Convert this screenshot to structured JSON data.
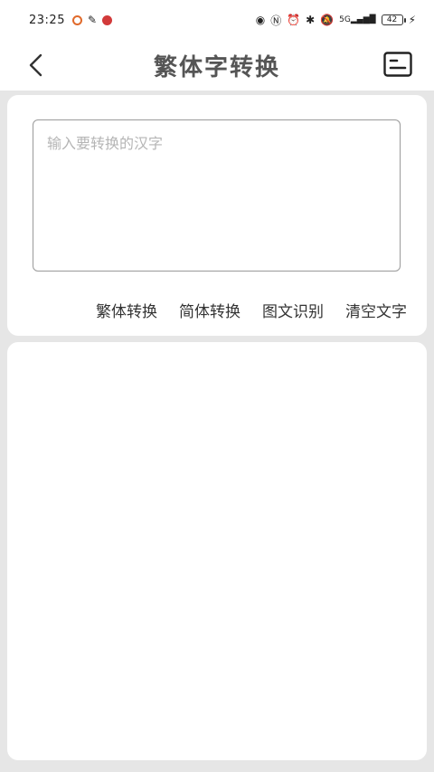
{
  "status_bar": {
    "time": "23:25",
    "battery": "42",
    "network": "5G",
    "left_icons": [
      "app-notification-icon",
      "text-app-icon",
      "red-app-icon"
    ],
    "right_icons": [
      "eye-icon",
      "nfc-icon",
      "alarm-icon",
      "bluetooth-icon",
      "mute-icon",
      "signal-icon",
      "battery-icon",
      "charging-icon"
    ]
  },
  "header": {
    "title": "繁体字转换",
    "back_icon": "chevron-left-icon",
    "history_icon": "list-card-icon"
  },
  "input": {
    "placeholder": "输入要转换的汉字",
    "value": ""
  },
  "actions": [
    {
      "label": "繁体转换"
    },
    {
      "label": "简体转换"
    },
    {
      "label": "图文识别"
    },
    {
      "label": "清空文字"
    }
  ],
  "result": {
    "text": ""
  },
  "colors": {
    "background": "#e6e6e6",
    "card": "#ffffff",
    "title": "#555555",
    "placeholder": "#b5b5b5"
  }
}
